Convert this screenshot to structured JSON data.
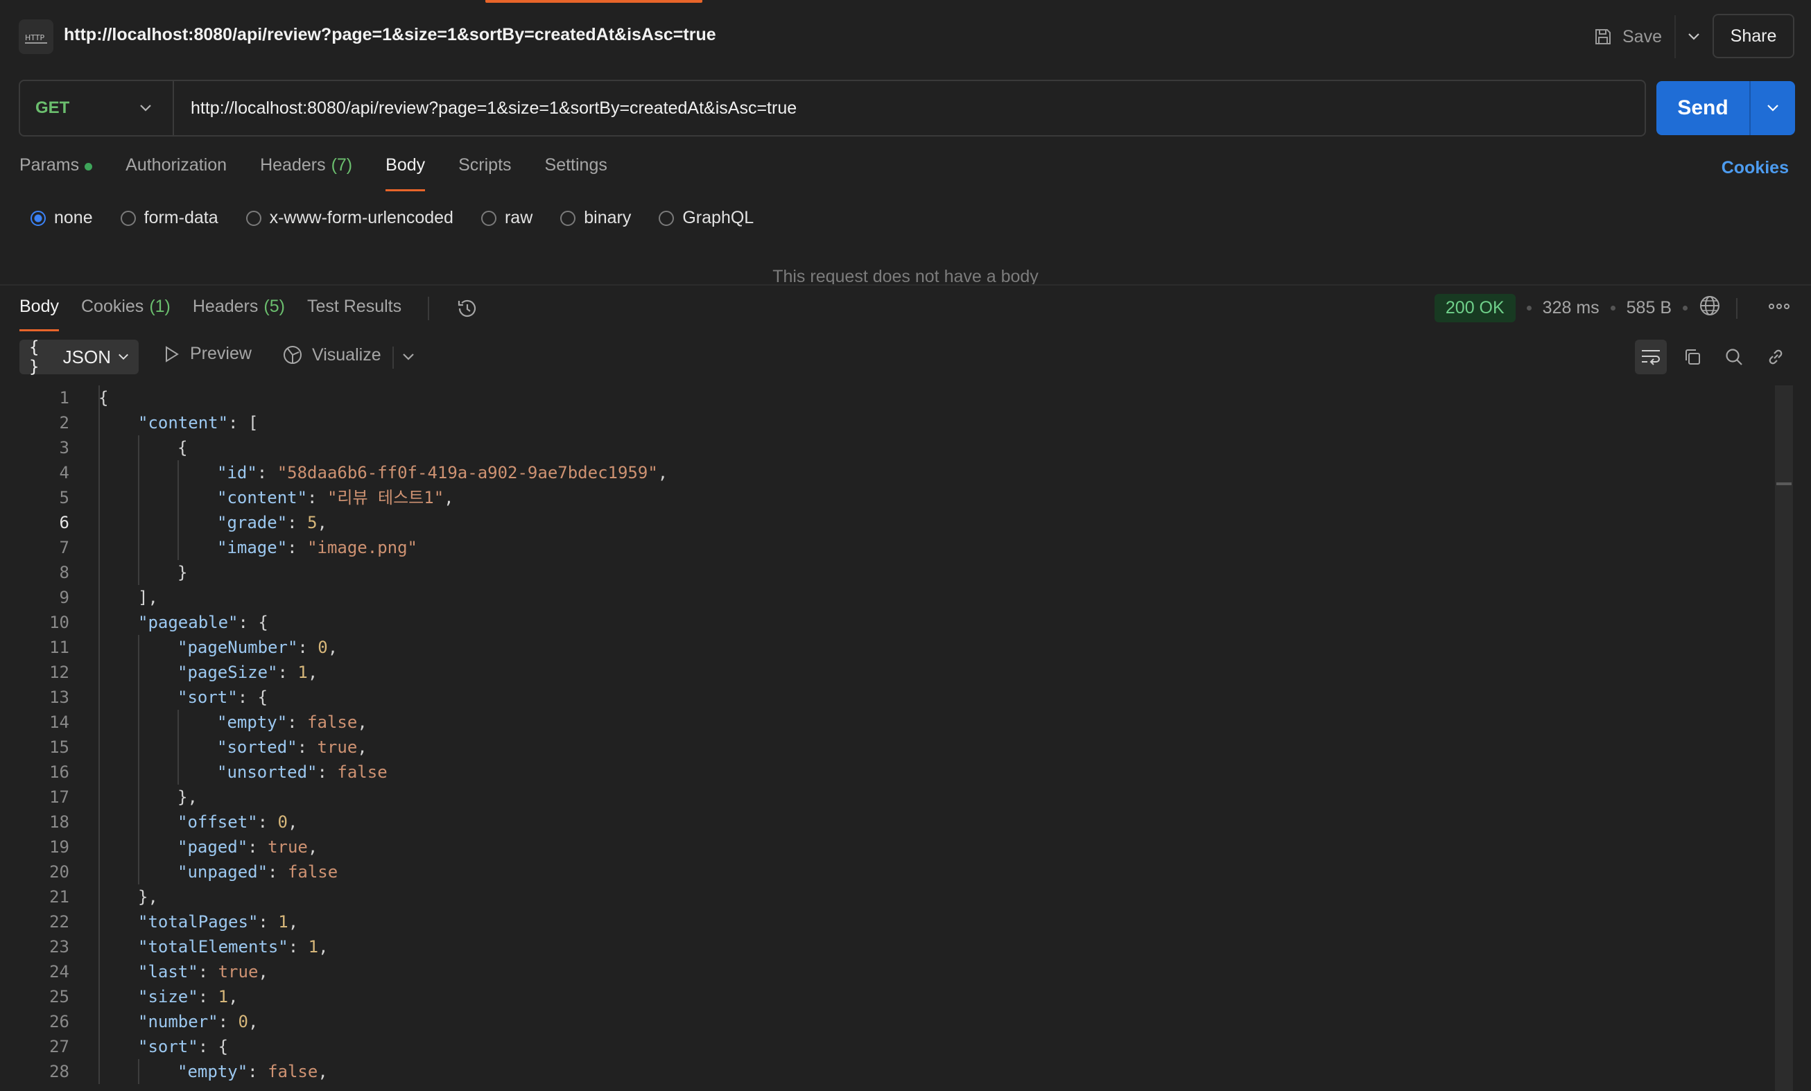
{
  "titlebar": {
    "http_icon_label": "HTTP",
    "title": "http://localhost:8080/api/review?page=1&size=1&sortBy=createdAt&isAsc=true",
    "save_label": "Save",
    "share_label": "Share"
  },
  "request": {
    "method": "GET",
    "url": "http://localhost:8080/api/review?page=1&size=1&sortBy=createdAt&isAsc=true",
    "send_label": "Send"
  },
  "req_tabs": {
    "params": "Params",
    "authorization": "Authorization",
    "headers": "Headers",
    "headers_count": "(7)",
    "body": "Body",
    "scripts": "Scripts",
    "settings": "Settings",
    "cookies": "Cookies"
  },
  "body_types": {
    "none": "none",
    "form_data": "form-data",
    "urlencoded": "x-www-form-urlencoded",
    "raw": "raw",
    "binary": "binary",
    "graphql": "GraphQL",
    "selected": "none"
  },
  "no_body_message": "This request does not have a body",
  "res_tabs": {
    "body": "Body",
    "cookies": "Cookies",
    "cookies_count": "(1)",
    "headers": "Headers",
    "headers_count": "(5)",
    "test_results": "Test Results"
  },
  "status": {
    "code": "200 OK",
    "time": "328 ms",
    "size": "585 B"
  },
  "viewer": {
    "format_label": "JSON",
    "preview_label": "Preview",
    "visualize_label": "Visualize"
  },
  "code_lines": [
    {
      "n": "1",
      "indent": 0,
      "tokens": [
        [
          "p",
          "{"
        ]
      ]
    },
    {
      "n": "2",
      "indent": 1,
      "tokens": [
        [
          "k",
          "\"content\""
        ],
        [
          "p",
          ": ["
        ]
      ]
    },
    {
      "n": "3",
      "indent": 2,
      "tokens": [
        [
          "p",
          "{"
        ]
      ]
    },
    {
      "n": "4",
      "indent": 3,
      "tokens": [
        [
          "k",
          "\"id\""
        ],
        [
          "p",
          ": "
        ],
        [
          "s",
          "\"58daa6b6-ff0f-419a-a902-9ae7bdec1959\""
        ],
        [
          "p",
          ","
        ]
      ]
    },
    {
      "n": "5",
      "indent": 3,
      "tokens": [
        [
          "k",
          "\"content\""
        ],
        [
          "p",
          ": "
        ],
        [
          "s",
          "\"리뷰 테스트1\""
        ],
        [
          "p",
          ","
        ]
      ]
    },
    {
      "n": "6",
      "indent": 3,
      "tokens": [
        [
          "k",
          "\"grade\""
        ],
        [
          "p",
          ": "
        ],
        [
          "n",
          "5"
        ],
        [
          "p",
          ","
        ]
      ]
    },
    {
      "n": "7",
      "indent": 3,
      "tokens": [
        [
          "k",
          "\"image\""
        ],
        [
          "p",
          ": "
        ],
        [
          "s",
          "\"image.png\""
        ]
      ]
    },
    {
      "n": "8",
      "indent": 2,
      "tokens": [
        [
          "p",
          "}"
        ]
      ]
    },
    {
      "n": "9",
      "indent": 1,
      "tokens": [
        [
          "p",
          "],"
        ]
      ]
    },
    {
      "n": "10",
      "indent": 1,
      "tokens": [
        [
          "k",
          "\"pageable\""
        ],
        [
          "p",
          ": {"
        ]
      ]
    },
    {
      "n": "11",
      "indent": 2,
      "tokens": [
        [
          "k",
          "\"pageNumber\""
        ],
        [
          "p",
          ": "
        ],
        [
          "n",
          "0"
        ],
        [
          "p",
          ","
        ]
      ]
    },
    {
      "n": "12",
      "indent": 2,
      "tokens": [
        [
          "k",
          "\"pageSize\""
        ],
        [
          "p",
          ": "
        ],
        [
          "n",
          "1"
        ],
        [
          "p",
          ","
        ]
      ]
    },
    {
      "n": "13",
      "indent": 2,
      "tokens": [
        [
          "k",
          "\"sort\""
        ],
        [
          "p",
          ": {"
        ]
      ]
    },
    {
      "n": "14",
      "indent": 3,
      "tokens": [
        [
          "k",
          "\"empty\""
        ],
        [
          "p",
          ": "
        ],
        [
          "b",
          "false"
        ],
        [
          "p",
          ","
        ]
      ]
    },
    {
      "n": "15",
      "indent": 3,
      "tokens": [
        [
          "k",
          "\"sorted\""
        ],
        [
          "p",
          ": "
        ],
        [
          "b",
          "true"
        ],
        [
          "p",
          ","
        ]
      ]
    },
    {
      "n": "16",
      "indent": 3,
      "tokens": [
        [
          "k",
          "\"unsorted\""
        ],
        [
          "p",
          ": "
        ],
        [
          "b",
          "false"
        ]
      ]
    },
    {
      "n": "17",
      "indent": 2,
      "tokens": [
        [
          "p",
          "},"
        ]
      ]
    },
    {
      "n": "18",
      "indent": 2,
      "tokens": [
        [
          "k",
          "\"offset\""
        ],
        [
          "p",
          ": "
        ],
        [
          "n",
          "0"
        ],
        [
          "p",
          ","
        ]
      ]
    },
    {
      "n": "19",
      "indent": 2,
      "tokens": [
        [
          "k",
          "\"paged\""
        ],
        [
          "p",
          ": "
        ],
        [
          "b",
          "true"
        ],
        [
          "p",
          ","
        ]
      ]
    },
    {
      "n": "20",
      "indent": 2,
      "tokens": [
        [
          "k",
          "\"unpaged\""
        ],
        [
          "p",
          ": "
        ],
        [
          "b",
          "false"
        ]
      ]
    },
    {
      "n": "21",
      "indent": 1,
      "tokens": [
        [
          "p",
          "},"
        ]
      ]
    },
    {
      "n": "22",
      "indent": 1,
      "tokens": [
        [
          "k",
          "\"totalPages\""
        ],
        [
          "p",
          ": "
        ],
        [
          "n",
          "1"
        ],
        [
          "p",
          ","
        ]
      ]
    },
    {
      "n": "23",
      "indent": 1,
      "tokens": [
        [
          "k",
          "\"totalElements\""
        ],
        [
          "p",
          ": "
        ],
        [
          "n",
          "1"
        ],
        [
          "p",
          ","
        ]
      ]
    },
    {
      "n": "24",
      "indent": 1,
      "tokens": [
        [
          "k",
          "\"last\""
        ],
        [
          "p",
          ": "
        ],
        [
          "b",
          "true"
        ],
        [
          "p",
          ","
        ]
      ]
    },
    {
      "n": "25",
      "indent": 1,
      "tokens": [
        [
          "k",
          "\"size\""
        ],
        [
          "p",
          ": "
        ],
        [
          "n",
          "1"
        ],
        [
          "p",
          ","
        ]
      ]
    },
    {
      "n": "26",
      "indent": 1,
      "tokens": [
        [
          "k",
          "\"number\""
        ],
        [
          "p",
          ": "
        ],
        [
          "n",
          "0"
        ],
        [
          "p",
          ","
        ]
      ]
    },
    {
      "n": "27",
      "indent": 1,
      "tokens": [
        [
          "k",
          "\"sort\""
        ],
        [
          "p",
          ": {"
        ]
      ]
    },
    {
      "n": "28",
      "indent": 2,
      "tokens": [
        [
          "k",
          "\"empty\""
        ],
        [
          "p",
          ": "
        ],
        [
          "b",
          "false"
        ],
        [
          "p",
          ","
        ]
      ]
    }
  ],
  "current_line": "6",
  "colors": {
    "accent": "#e8652a",
    "send": "#1f6dd6",
    "method": "#6bbe6e",
    "status_ok": "#6fd08a",
    "json_key": "#9cc8f0",
    "json_string": "#ce9272",
    "json_number": "#d7b77a"
  }
}
